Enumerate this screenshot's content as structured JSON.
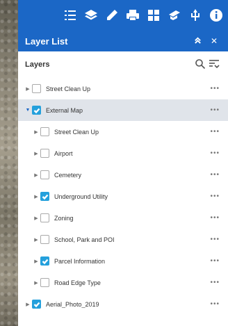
{
  "toolbar": {
    "tools": [
      {
        "icon": "list-icon"
      },
      {
        "icon": "layers-icon"
      },
      {
        "icon": "pencil-icon"
      },
      {
        "icon": "print-icon"
      },
      {
        "icon": "grid-icon"
      },
      {
        "icon": "bookmark-icon"
      },
      {
        "icon": "share-icon"
      },
      {
        "icon": "info-icon"
      }
    ]
  },
  "panel": {
    "title": "Layer List",
    "collapse_glyph": "≈",
    "close_glyph": "✕"
  },
  "layers": {
    "heading": "Layers",
    "items": [
      {
        "label": "Street Clean Up",
        "checked": false,
        "expanded": false,
        "level": 0
      },
      {
        "label": "External Map",
        "checked": true,
        "expanded": true,
        "level": 0
      },
      {
        "label": "Street Clean Up",
        "checked": false,
        "expanded": false,
        "level": 1
      },
      {
        "label": "Airport",
        "checked": false,
        "expanded": false,
        "level": 1
      },
      {
        "label": "Cemetery",
        "checked": false,
        "expanded": false,
        "level": 1
      },
      {
        "label": "Underground Utility",
        "checked": true,
        "expanded": false,
        "level": 1
      },
      {
        "label": "Zoning",
        "checked": false,
        "expanded": false,
        "level": 1
      },
      {
        "label": "School, Park and POI",
        "checked": false,
        "expanded": false,
        "level": 1
      },
      {
        "label": "Parcel Information",
        "checked": true,
        "expanded": false,
        "level": 1
      },
      {
        "label": "Road Edge Type",
        "checked": false,
        "expanded": false,
        "level": 1
      },
      {
        "label": "Aerial_Photo_2019",
        "checked": true,
        "expanded": false,
        "level": 0
      }
    ],
    "more_glyph": "•••"
  },
  "colors": {
    "accent": "#1b67c6",
    "check": "#24a0dc",
    "selected_row": "#e0e4ea"
  }
}
